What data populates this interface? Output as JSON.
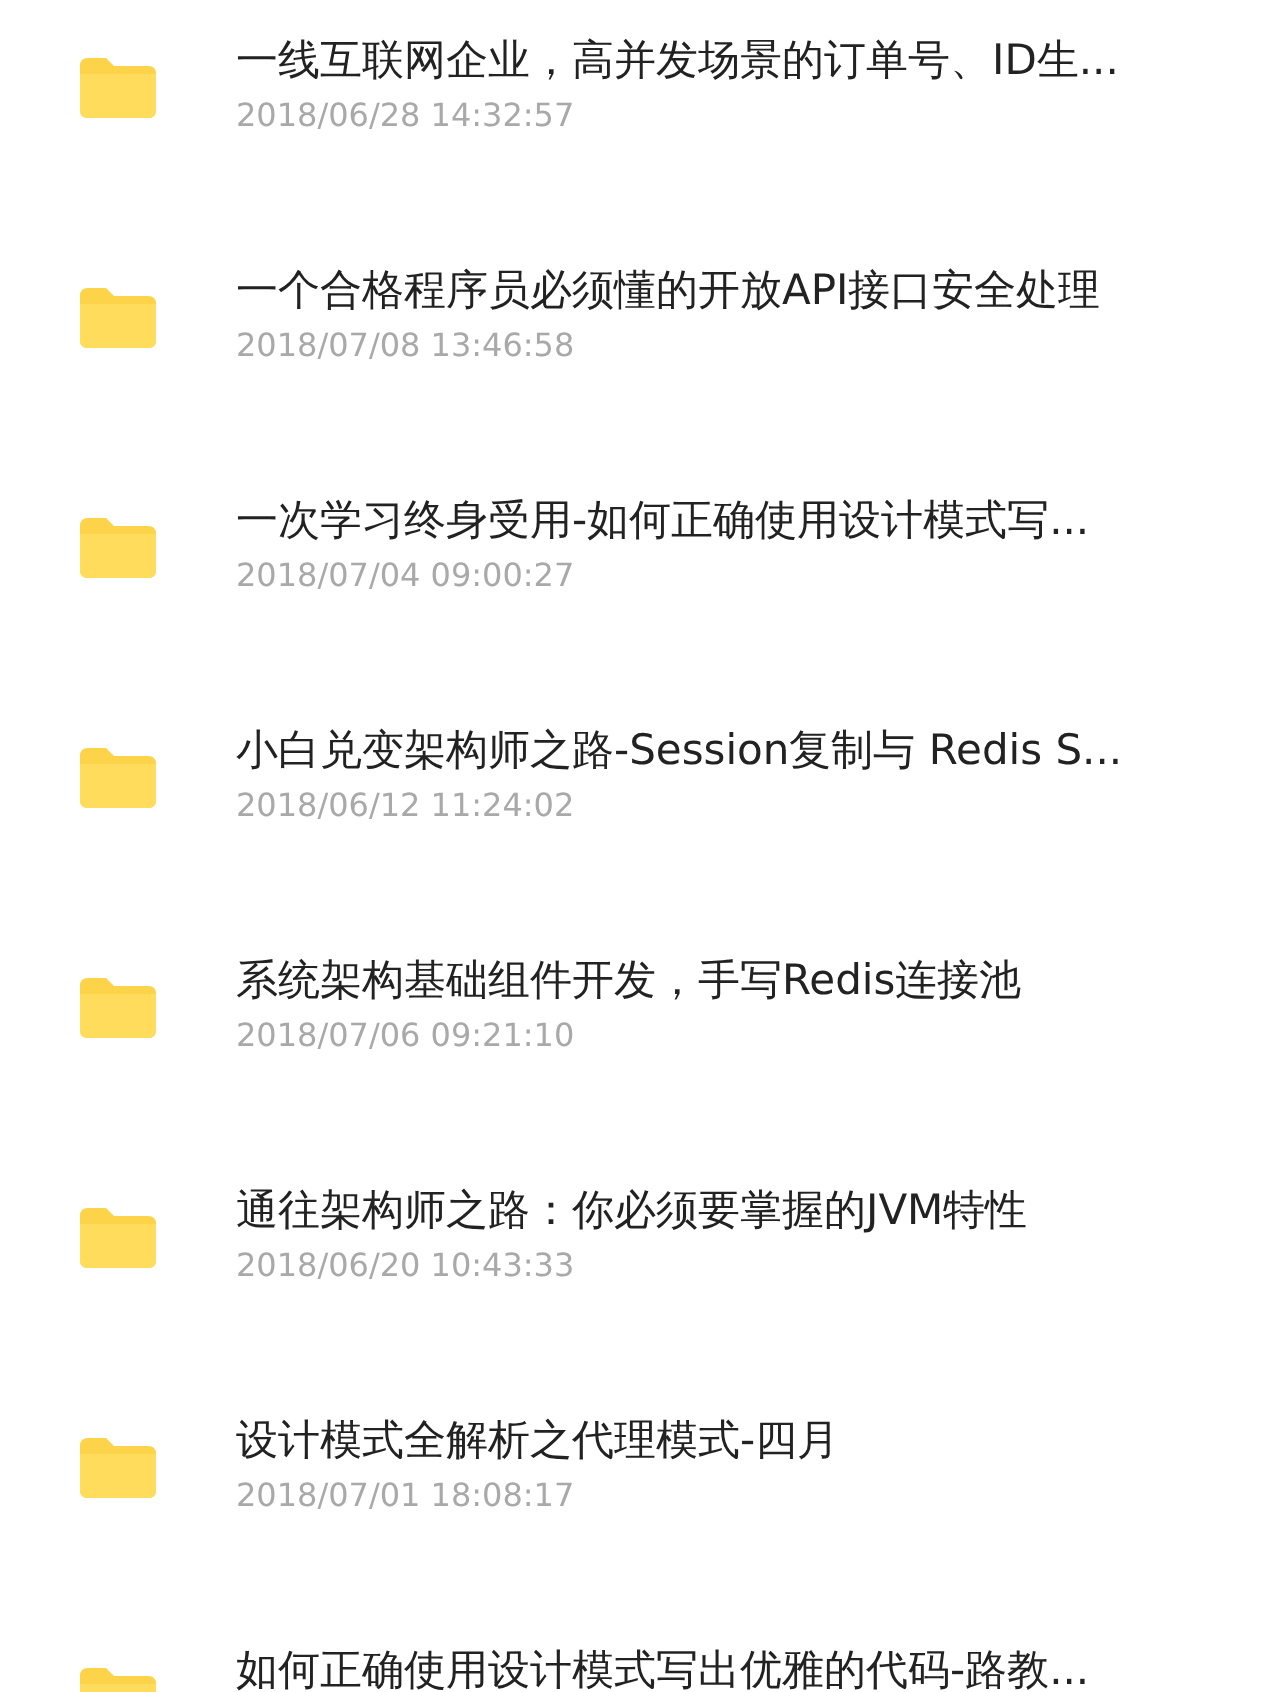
{
  "files": [
    {
      "title": "一线互联网企业，高并发场景的订单号、ID生...",
      "date": "2018/06/28 14:32:57"
    },
    {
      "title": "一个合格程序员必须懂的开放API接口安全处理",
      "date": "2018/07/08 13:46:58"
    },
    {
      "title": "一次学习终身受用-如何正确使用设计模式写...",
      "date": "2018/07/04 09:00:27"
    },
    {
      "title": "小白兑变架构师之路-Session复制与 Redis S...",
      "date": "2018/06/12 11:24:02"
    },
    {
      "title": "系统架构基础组件开发，手写Redis连接池",
      "date": "2018/07/06 09:21:10"
    },
    {
      "title": "通往架构师之路：你必须要掌握的JVM特性",
      "date": "2018/06/20 10:43:33"
    },
    {
      "title": "设计模式全解析之代理模式-四月",
      "date": "2018/07/01 18:08:17"
    },
    {
      "title": "如何正确使用设计模式写出优雅的代码-路教..."
    }
  ]
}
